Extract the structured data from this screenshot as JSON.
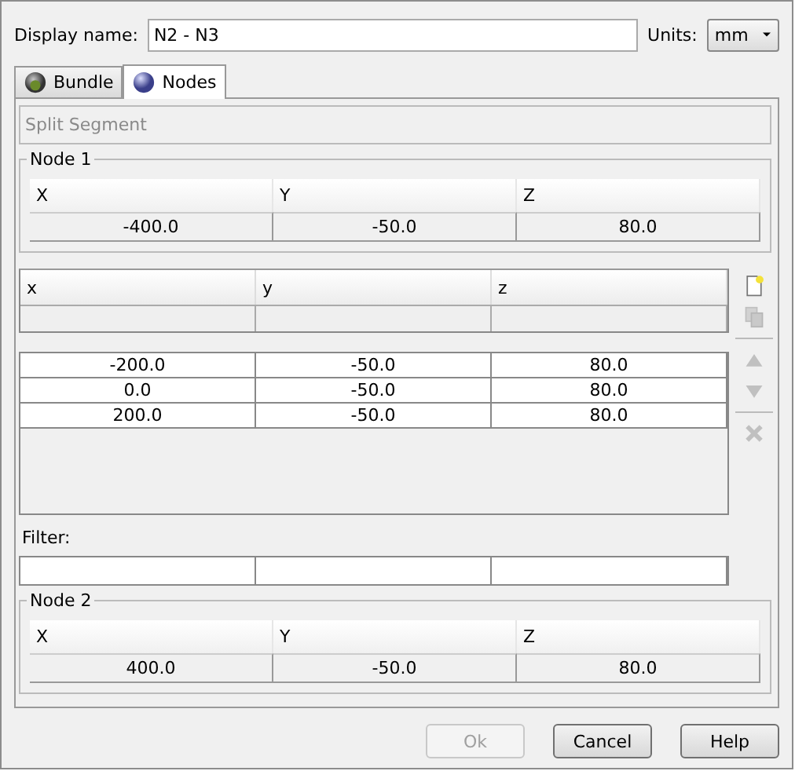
{
  "display_name": {
    "label": "Display name:",
    "value": "N2 - N3"
  },
  "units": {
    "label": "Units:",
    "value": "mm"
  },
  "tabs": [
    {
      "label": "Bundle",
      "selected": false,
      "kind": "bundle"
    },
    {
      "label": "Nodes",
      "selected": true,
      "kind": "nodes"
    }
  ],
  "split_segment": {
    "label": "Split Segment",
    "disabled": true
  },
  "node_1": {
    "title": "Node 1",
    "columns": [
      "X",
      "Y",
      "Z"
    ],
    "values": [
      "-400.0",
      "-50.0",
      "80.0"
    ]
  },
  "points_table": {
    "columns": [
      "x",
      "y",
      "z"
    ],
    "rows": [
      [
        "-200.0",
        "-50.0",
        "80.0"
      ],
      [
        "0.0",
        "-50.0",
        "80.0"
      ],
      [
        "200.0",
        "-50.0",
        "80.0"
      ]
    ]
  },
  "toolbar": [
    [
      {
        "kind": "new",
        "disabled": false
      },
      {
        "kind": "copy",
        "disabled": true
      }
    ],
    [
      {
        "kind": "up",
        "disabled": true
      },
      {
        "kind": "down",
        "disabled": true
      }
    ],
    [
      {
        "kind": "delete",
        "disabled": true
      }
    ]
  ],
  "filter": {
    "label": "Filter:"
  },
  "node_2": {
    "title": "Node 2",
    "columns": [
      "X",
      "Y",
      "Z"
    ],
    "values": [
      "400.0",
      "-50.0",
      "80.0"
    ]
  },
  "buttons": [
    {
      "label": "Ok",
      "disabled": true
    },
    {
      "label": "Cancel",
      "disabled": false
    },
    {
      "label": "Help",
      "disabled": false
    }
  ]
}
